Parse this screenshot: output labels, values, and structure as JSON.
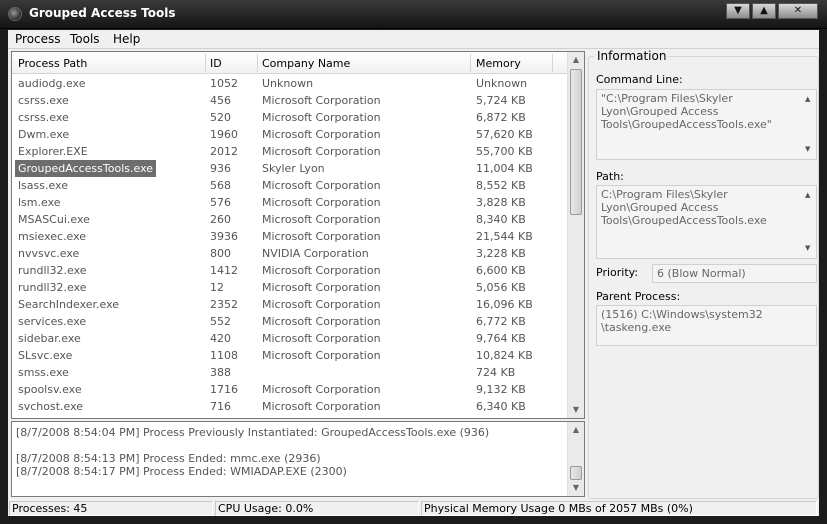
{
  "window": {
    "title": "Grouped Access Tools",
    "icon": "app-gear-icon",
    "min_glyph": "▼",
    "max_glyph": "▲",
    "close_glyph": "✕"
  },
  "menu": [
    {
      "label": "Process"
    },
    {
      "label": "Tools"
    },
    {
      "label": "Help"
    }
  ],
  "process_list": {
    "columns": [
      "Process Path",
      "ID",
      "Company Name",
      "Memory"
    ],
    "selected_index": 5,
    "rows": [
      {
        "name": "audiodg.exe",
        "id": "1052",
        "company": "Unknown",
        "memory": "Unknown"
      },
      {
        "name": "csrss.exe",
        "id": "456",
        "company": "Microsoft Corporation",
        "memory": "5,724 KB"
      },
      {
        "name": "csrss.exe",
        "id": "520",
        "company": "Microsoft Corporation",
        "memory": "6,872 KB"
      },
      {
        "name": "Dwm.exe",
        "id": "1960",
        "company": "Microsoft Corporation",
        "memory": "57,620 KB"
      },
      {
        "name": "Explorer.EXE",
        "id": "2012",
        "company": "Microsoft Corporation",
        "memory": "55,700 KB"
      },
      {
        "name": "GroupedAccessTools.exe",
        "id": "936",
        "company": "Skyler Lyon",
        "memory": "11,004 KB"
      },
      {
        "name": "lsass.exe",
        "id": "568",
        "company": "Microsoft Corporation",
        "memory": "8,552 KB"
      },
      {
        "name": "lsm.exe",
        "id": "576",
        "company": "Microsoft Corporation",
        "memory": "3,828 KB"
      },
      {
        "name": "MSASCui.exe",
        "id": "260",
        "company": "Microsoft Corporation",
        "memory": "8,340 KB"
      },
      {
        "name": "msiexec.exe",
        "id": "3936",
        "company": "Microsoft Corporation",
        "memory": "21,544 KB"
      },
      {
        "name": "nvvsvc.exe",
        "id": "800",
        "company": "NVIDIA Corporation",
        "memory": "3,228 KB"
      },
      {
        "name": "rundll32.exe",
        "id": "1412",
        "company": "Microsoft Corporation",
        "memory": "6,600 KB"
      },
      {
        "name": "rundll32.exe",
        "id": "12",
        "company": "Microsoft Corporation",
        "memory": "5,056 KB"
      },
      {
        "name": "SearchIndexer.exe",
        "id": "2352",
        "company": "Microsoft Corporation",
        "memory": "16,096 KB"
      },
      {
        "name": "services.exe",
        "id": "552",
        "company": "Microsoft Corporation",
        "memory": "6,772 KB"
      },
      {
        "name": "sidebar.exe",
        "id": "420",
        "company": "Microsoft Corporation",
        "memory": "9,764 KB"
      },
      {
        "name": "SLsvc.exe",
        "id": "1108",
        "company": "Microsoft Corporation",
        "memory": "10,824 KB"
      },
      {
        "name": "smss.exe",
        "id": "388",
        "company": "",
        "memory": "724 KB"
      },
      {
        "name": "spoolsv.exe",
        "id": "1716",
        "company": "Microsoft Corporation",
        "memory": "9,132 KB"
      },
      {
        "name": "svchost.exe",
        "id": "716",
        "company": "Microsoft Corporation",
        "memory": "6,340 KB"
      }
    ]
  },
  "log": [
    "[8/7/2008 8:54:04 PM] Process Previously Instantiated: GroupedAccessTools.exe (936)",
    "",
    "[8/7/2008 8:54:13 PM] Process Ended: mmc.exe (2936)",
    "[8/7/2008 8:54:17 PM] Process Ended: WMIADAP.EXE (2300)"
  ],
  "info": {
    "legend": "Information",
    "command_line_label": "Command Line:",
    "command_line_lines": [
      "\"C:\\Program Files\\Skyler",
      "Lyon\\Grouped Access",
      "Tools\\GroupedAccessTools.exe\""
    ],
    "path_label": "Path:",
    "path_lines": [
      "C:\\Program Files\\Skyler",
      "Lyon\\Grouped Access",
      "Tools\\GroupedAccessTools.exe"
    ],
    "priority_label": "Priority:",
    "priority_value": "6 (Blow Normal)",
    "parent_label": "Parent Process:",
    "parent_lines": [
      "(1516) C:\\Windows\\system32",
      "\\taskeng.exe"
    ]
  },
  "status": {
    "processes": "Processes: 45",
    "cpu": "CPU Usage: 0.0%",
    "memory": "Physical Memory Usage 0 MBs of 2057 MBs (0%)"
  },
  "scroll_glyphs": {
    "up": "▲",
    "down": "▼"
  }
}
